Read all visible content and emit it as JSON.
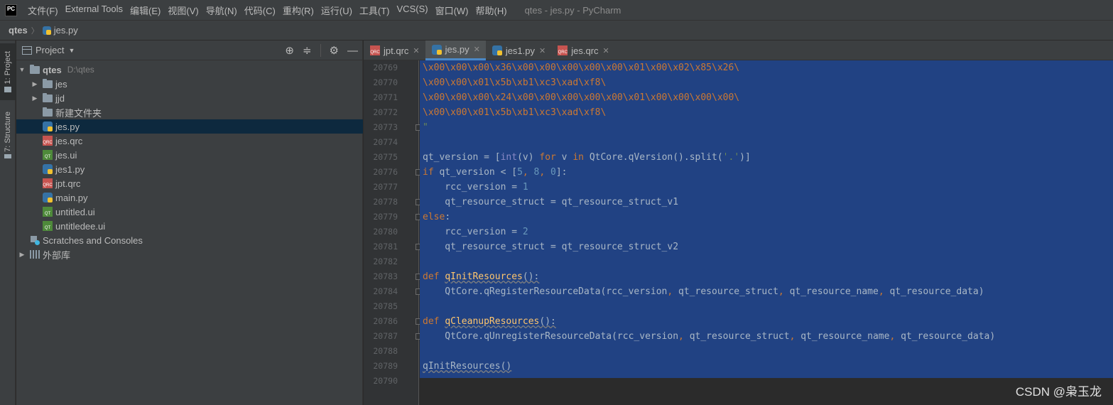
{
  "menu": {
    "logo": "PC",
    "items": [
      "文件(F)",
      "External Tools",
      "编辑(E)",
      "视图(V)",
      "导航(N)",
      "代码(C)",
      "重构(R)",
      "运行(U)",
      "工具(T)",
      "VCS(S)",
      "窗口(W)",
      "帮助(H)"
    ],
    "window_title": "qtes - jes.py - PyCharm"
  },
  "navbar": {
    "root": "qtes",
    "file": "jes.py"
  },
  "tool_strip": {
    "project_tab": "1: Project",
    "structure_tab": "7: Structure"
  },
  "project_panel": {
    "title": "Project",
    "tree": [
      {
        "label": "qtes",
        "path": "D:\\qtes",
        "type": "folder",
        "depth": 0,
        "expanded": true
      },
      {
        "label": "jes",
        "type": "folder",
        "depth": 1,
        "expanded": false
      },
      {
        "label": "jjd",
        "type": "folder",
        "depth": 1,
        "expanded": false
      },
      {
        "label": "新建文件夹",
        "type": "folder",
        "depth": 1
      },
      {
        "label": "jes.py",
        "type": "py",
        "depth": 1,
        "selected": true
      },
      {
        "label": "jes.qrc",
        "type": "qrc",
        "depth": 1
      },
      {
        "label": "jes.ui",
        "type": "ui",
        "depth": 1
      },
      {
        "label": "jes1.py",
        "type": "py",
        "depth": 1
      },
      {
        "label": "jpt.qrc",
        "type": "qrc",
        "depth": 1
      },
      {
        "label": "main.py",
        "type": "py",
        "depth": 1
      },
      {
        "label": "untitled.ui",
        "type": "ui",
        "depth": 1
      },
      {
        "label": "untitledee.ui",
        "type": "ui",
        "depth": 1
      },
      {
        "label": "Scratches and Consoles",
        "type": "scratch",
        "depth": 0
      },
      {
        "label": "外部库",
        "type": "lib",
        "depth": 0,
        "expanded": false
      }
    ]
  },
  "editor": {
    "tabs": [
      {
        "label": "jpt.qrc",
        "type": "qrc",
        "active": false
      },
      {
        "label": "jes.py",
        "type": "py",
        "active": true
      },
      {
        "label": "jes1.py",
        "type": "py",
        "active": false
      },
      {
        "label": "jes.qrc",
        "type": "qrc",
        "active": false
      }
    ],
    "lines": [
      {
        "no": "20769",
        "html": "<span style=\"color:#cc7832\">\\x00\\x00\\x00\\x36\\x00\\x00\\x00\\x00\\x00\\x01\\x00\\x02\\x85\\x26\\</span>"
      },
      {
        "no": "20770",
        "html": "<span style=\"color:#cc7832\">\\x00\\x00\\x01\\x5b\\xb1\\xc3\\xad\\xf8\\</span>"
      },
      {
        "no": "20771",
        "html": "<span style=\"color:#cc7832\">\\x00\\x00\\x00\\x24\\x00\\x00\\x00\\x00\\x00\\x01\\x00\\x00\\x00\\x00\\</span>"
      },
      {
        "no": "20772",
        "html": "<span style=\"color:#cc7832\">\\x00\\x00\\x01\\x5b\\xb1\\xc3\\xad\\xf8\\</span>"
      },
      {
        "no": "20773",
        "html": "<span style=\"color:#6a8759\">\"</span>",
        "fold": true
      },
      {
        "no": "20774",
        "html": ""
      },
      {
        "no": "20775",
        "html": "<span style=\"color:#a9b7c6\">qt_version = [</span><span style=\"color:#8888c6\">int</span><span style=\"color:#a9b7c6\">(v) </span><span style=\"color:#cc7832\">for</span><span style=\"color:#a9b7c6\"> v </span><span style=\"color:#cc7832\">in</span><span style=\"color:#a9b7c6\"> QtCore.qVersion().split(</span><span style=\"color:#6a8759\">'.'</span><span style=\"color:#a9b7c6\">)]</span>"
      },
      {
        "no": "20776",
        "html": "<span style=\"color:#cc7832\">if</span><span style=\"color:#a9b7c6\"> qt_version &lt; [</span><span style=\"color:#6897bb\">5</span><span style=\"color:#cc7832\">, </span><span style=\"color:#6897bb\">8</span><span style=\"color:#cc7832\">, </span><span style=\"color:#6897bb\">0</span><span style=\"color:#a9b7c6\">]:</span>",
        "fold": true
      },
      {
        "no": "20777",
        "html": "<span style=\"color:#a9b7c6\">    rcc_version = </span><span style=\"color:#6897bb\">1</span>"
      },
      {
        "no": "20778",
        "html": "<span style=\"color:#a9b7c6\">    qt_resource_struct = qt_resource_struct_v1</span>",
        "fold": true
      },
      {
        "no": "20779",
        "html": "<span style=\"color:#cc7832\">else</span><span style=\"color:#a9b7c6\">:</span>",
        "fold": true
      },
      {
        "no": "20780",
        "html": "<span style=\"color:#a9b7c6\">    rcc_version = </span><span style=\"color:#6897bb\">2</span>"
      },
      {
        "no": "20781",
        "html": "<span style=\"color:#a9b7c6\">    qt_resource_struct = qt_resource_struct_v2</span>",
        "fold": true
      },
      {
        "no": "20782",
        "html": ""
      },
      {
        "no": "20783",
        "html": "<span style=\"color:#cc7832\">def </span><span style=\"color:#ffc66d;text-decoration:underline wavy #808080\">qInitResources</span><span style=\"color:#a9b7c6;text-decoration:underline wavy #808080\">():</span>",
        "fold": true
      },
      {
        "no": "20784",
        "html": "<span style=\"color:#a9b7c6\">    QtCore.qRegisterResourceData(rcc_version</span><span style=\"color:#cc7832\">, </span><span style=\"color:#a9b7c6\">qt_resource_struct</span><span style=\"color:#cc7832\">, </span><span style=\"color:#a9b7c6\">qt_resource_name</span><span style=\"color:#cc7832\">, </span><span style=\"color:#a9b7c6\">qt_resource_data)</span>",
        "fold": true
      },
      {
        "no": "20785",
        "html": ""
      },
      {
        "no": "20786",
        "html": "<span style=\"color:#cc7832\">def </span><span style=\"color:#ffc66d;text-decoration:underline wavy #808080\">qCleanupResources</span><span style=\"color:#a9b7c6;text-decoration:underline wavy #808080\">():</span>",
        "fold": true
      },
      {
        "no": "20787",
        "html": "<span style=\"color:#a9b7c6\">    QtCore.qUnregisterResourceData(rcc_version</span><span style=\"color:#cc7832\">, </span><span style=\"color:#a9b7c6\">qt_resource_struct</span><span style=\"color:#cc7832\">, </span><span style=\"color:#a9b7c6\">qt_resource_name</span><span style=\"color:#cc7832\">, </span><span style=\"color:#a9b7c6\">qt_resource_data)</span>",
        "fold": true
      },
      {
        "no": "20788",
        "html": ""
      },
      {
        "no": "20789",
        "html": "<span style=\"color:#a9b7c6;text-decoration:underline wavy #808080\">qInitResources()</span>"
      },
      {
        "no": "20790",
        "html": ""
      }
    ]
  },
  "watermark": "CSDN @枭玉龙",
  "colors": {
    "background": "#2b2b2b",
    "panel": "#3c3f41",
    "selection": "#214283",
    "tree_selected": "#0d293e",
    "keyword": "#cc7832",
    "number": "#6897bb",
    "string": "#6a8759",
    "function": "#ffc66d"
  }
}
